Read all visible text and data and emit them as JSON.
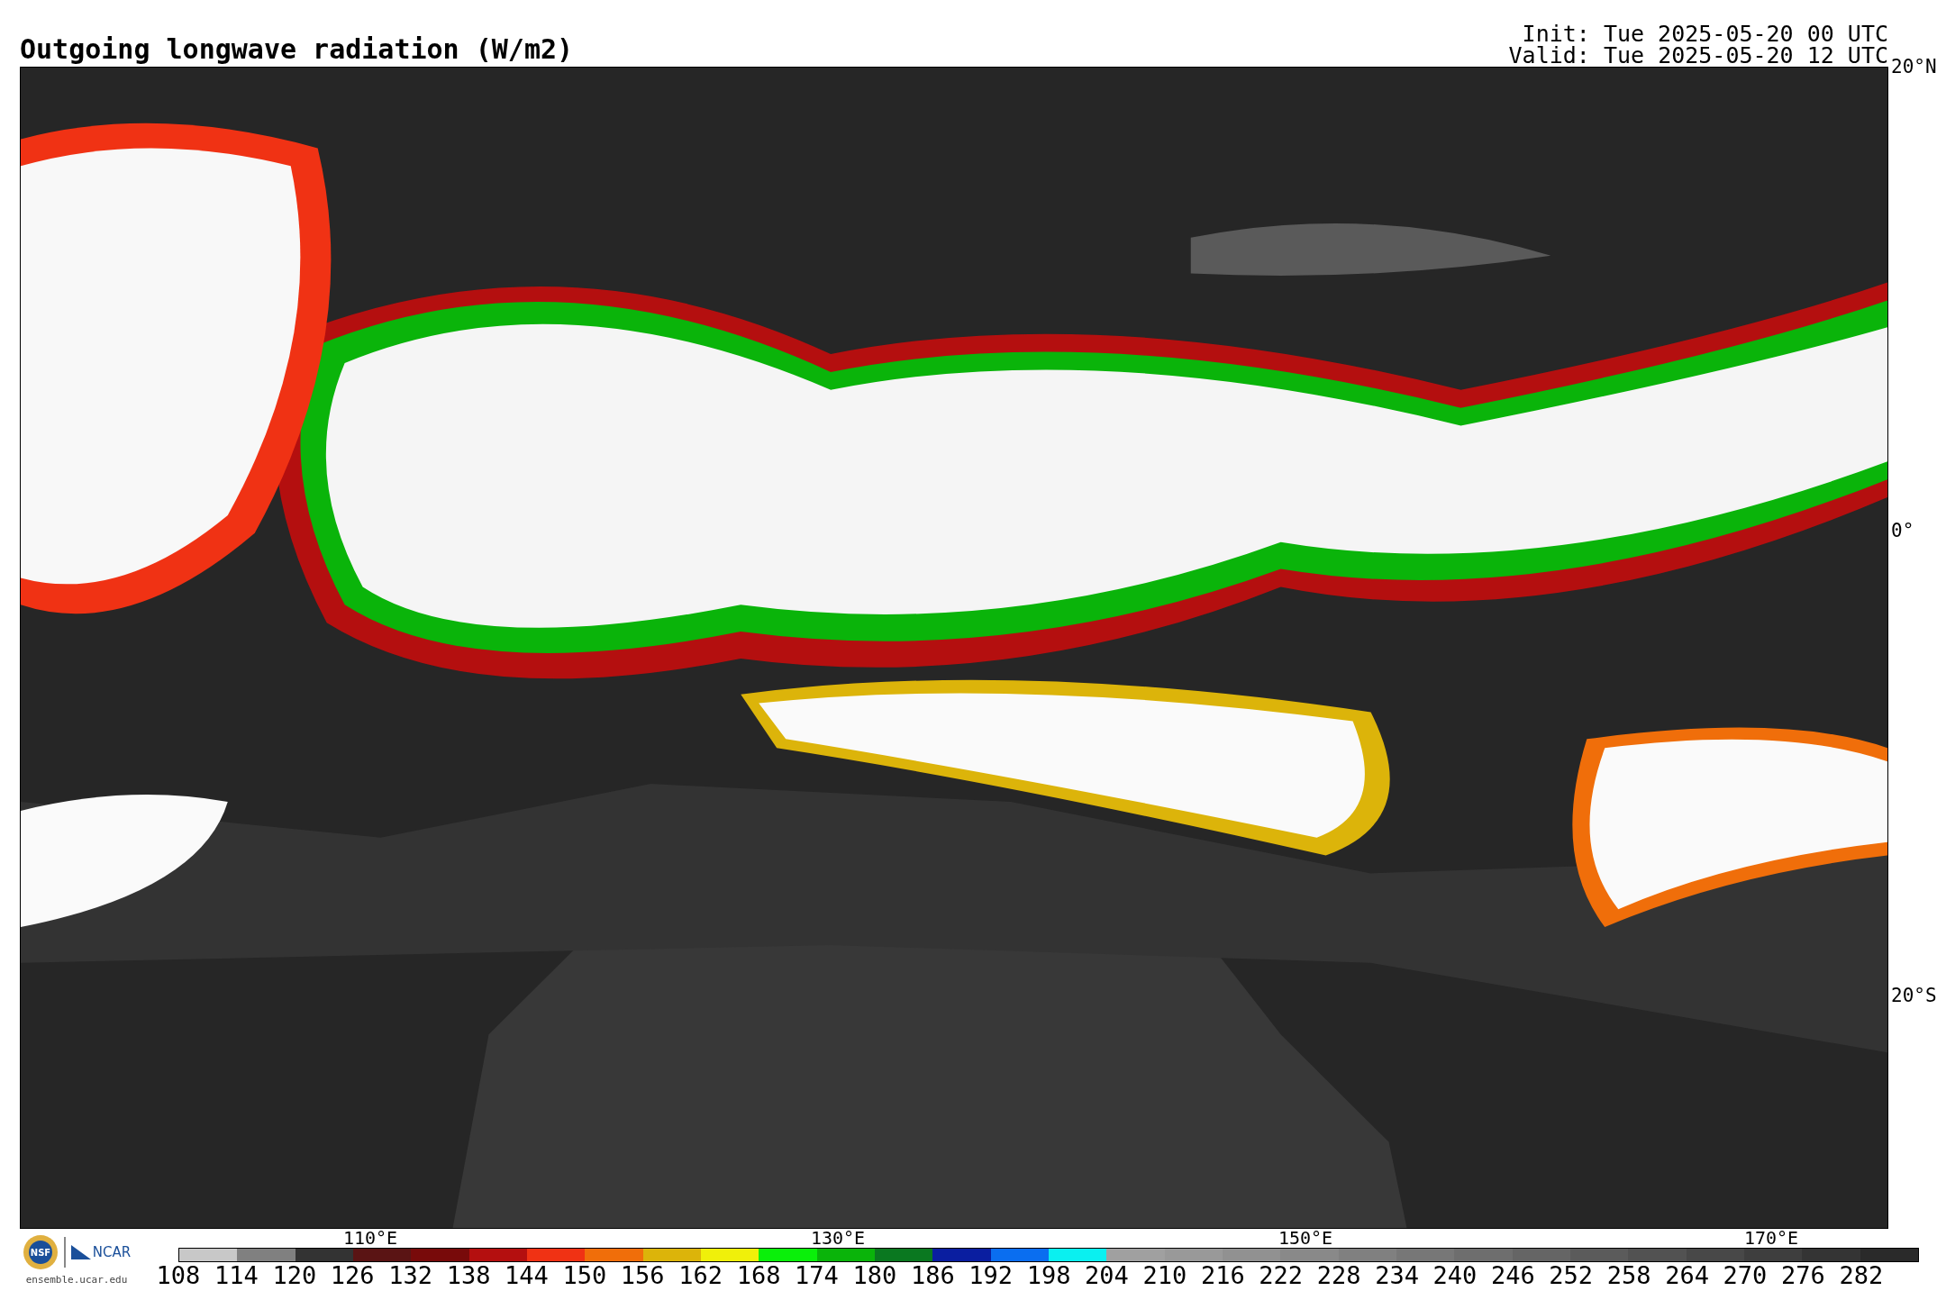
{
  "title": "Outgoing longwave radiation (W/m2)",
  "init": "Init: Tue 2025-05-20 00 UTC",
  "valid": "Valid: Tue 2025-05-20 12 UTC",
  "map": {
    "latitude_labels": [
      "20°N",
      "0°",
      "20°S"
    ],
    "longitude_labels": [
      "110°E",
      "130°E",
      "150°E",
      "170°E"
    ]
  },
  "logos": {
    "seal": "NSF",
    "wordmark": "NCAR",
    "url": "ensemble.ucar.edu"
  },
  "colorbar": {
    "swatches": [
      {
        "label": "108",
        "color": "#c8c8c8"
      },
      {
        "label": "114",
        "color": "#808080"
      },
      {
        "label": "120",
        "color": "#333333"
      },
      {
        "label": "126",
        "color": "#5a1414"
      },
      {
        "label": "132",
        "color": "#780a0a"
      },
      {
        "label": "138",
        "color": "#b40f0f"
      },
      {
        "label": "144",
        "color": "#f03214"
      },
      {
        "label": "150",
        "color": "#f06e0a"
      },
      {
        "label": "156",
        "color": "#dcb40a"
      },
      {
        "label": "162",
        "color": "#f0f00a"
      },
      {
        "label": "168",
        "color": "#0af00a"
      },
      {
        "label": "174",
        "color": "#0ab40a"
      },
      {
        "label": "180",
        "color": "#0a7820"
      },
      {
        "label": "186",
        "color": "#0a1ea0"
      },
      {
        "label": "192",
        "color": "#0a6ef0"
      },
      {
        "label": "198",
        "color": "#0af0f0"
      },
      {
        "label": "204",
        "color": "#a0a0a0"
      },
      {
        "label": "210",
        "color": "#999999"
      },
      {
        "label": "216",
        "color": "#919191"
      },
      {
        "label": "222",
        "color": "#898989"
      },
      {
        "label": "228",
        "color": "#808080"
      },
      {
        "label": "234",
        "color": "#777777"
      },
      {
        "label": "240",
        "color": "#6e6e6e"
      },
      {
        "label": "246",
        "color": "#656565"
      },
      {
        "label": "252",
        "color": "#5b5b5b"
      },
      {
        "label": "258",
        "color": "#525252"
      },
      {
        "label": "264",
        "color": "#484848"
      },
      {
        "label": "270",
        "color": "#3e3e3e"
      },
      {
        "label": "276",
        "color": "#343434"
      },
      {
        "label": "282",
        "color": "#2a2a2a"
      }
    ]
  }
}
